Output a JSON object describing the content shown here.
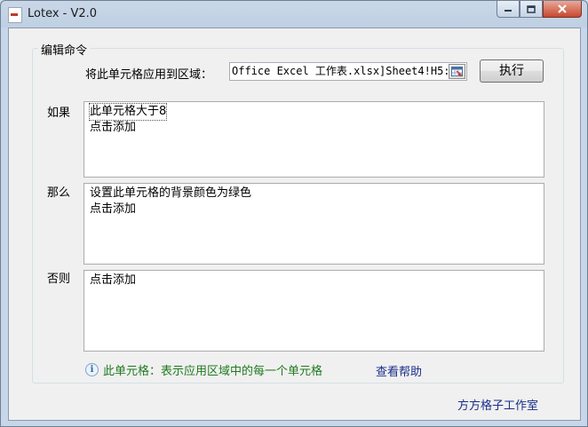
{
  "window": {
    "title": "Lotex - V2.0",
    "controls": {
      "minimize_icon": "minimize-icon",
      "maximize_icon": "maximize-icon",
      "close_icon": "close-icon"
    }
  },
  "editor": {
    "group_title": "编辑命令",
    "range_label": "将此单元格应用到区域：",
    "range_value": "Office Excel 工作表.xlsx]Sheet4!H5:",
    "range_picker_icon": "range-select-icon",
    "execute_label": "执行",
    "if_label": "如果",
    "if_items": [
      "此单元格大于8",
      "点击添加"
    ],
    "then_label": "那么",
    "then_items": [
      "设置此单元格的背景颜色为绿色",
      "点击添加"
    ],
    "else_label": "否则",
    "else_items": [
      "点击添加"
    ]
  },
  "footer": {
    "info_icon": "info-icon",
    "hint": "此单元格：表示应用区域中的每一个单元格",
    "help_link": "查看帮助",
    "studio_link": "方方格子工作室"
  },
  "colors": {
    "hint_text": "#1f7a1f",
    "link_text": "#1a2d8a",
    "close_button": "#c7482c"
  }
}
